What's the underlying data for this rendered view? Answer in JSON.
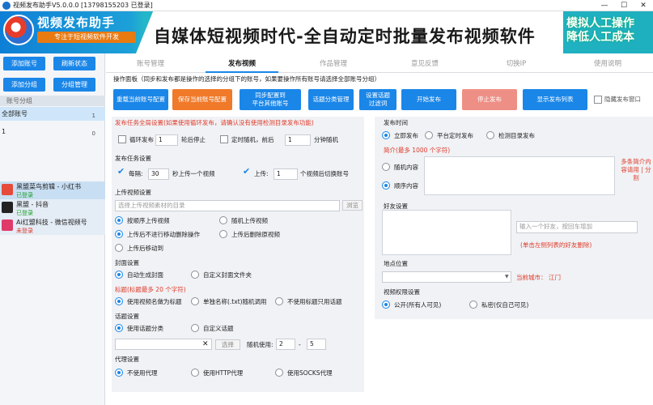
{
  "window": {
    "title": "视频发布助手V5.0.0.0 [13798155203 已登录]"
  },
  "banner": {
    "app_name": "视频发布助手",
    "app_sub": "专注于短视频软件开发",
    "slogan": "自媒体短视频时代-全自动定时批量发布视频软件",
    "badge_line1": "模拟人工操作",
    "badge_line2": "降低人工成本"
  },
  "sidebar": {
    "buttons": [
      "添加账号",
      "刷新状态",
      "添加分组",
      "分组管理"
    ],
    "group_header": "账号分组",
    "groups": [
      {
        "name": "全部账号",
        "count": "1"
      },
      {
        "name": "1",
        "count": "0"
      }
    ],
    "accounts": [
      {
        "name": "黑盟菜鸟剪辑 - 小红书",
        "status": "已登录",
        "status_color": "#1a9e2a",
        "avatar_color": "#e64a3a"
      },
      {
        "name": "黑盟 - 抖音",
        "status": "已登录",
        "status_color": "#1a9e2a",
        "avatar_color": "#222222"
      },
      {
        "name": "Ai红盟科技 - 微信视频号",
        "status": "未登录",
        "status_color": "#e03a2a",
        "avatar_color": "#e03a6a"
      }
    ]
  },
  "tabs": [
    "账号管理",
    "发布视频",
    "作品管理",
    "意见反馈",
    "切换IP",
    "使用说明"
  ],
  "ops": {
    "header": "操作面板（同步和发布都是操作的选择的分组下的账号，如果要操作所有账号请选择全部账号分组）",
    "btn1_l1": "重载当前账号配置",
    "btn2_l1": "保存当前账号配置",
    "btn3_l1": "同步配置到",
    "btn3_l2": "平台其他账号",
    "btn4_l1": "话题分类管理",
    "btn5_l1": "设置话题",
    "btn5_l2": "过滤词",
    "btn6_l1": "开始发布",
    "btn7_l1": "停止发布",
    "btn8_l1": "显示发布列表",
    "hide_window": "隐藏发布窗口"
  },
  "global": {
    "title": "发布任务全局设置(如果使用循环发布，请确认没有使用检测目录发布功能)",
    "loop_label": "循环发布",
    "loop_value": "1",
    "loop_suffix": "轮后停止",
    "random_label": "定时随机，前后",
    "random_value": "1",
    "random_suffix": "分钟随机"
  },
  "task": {
    "title": "发布任务设置",
    "every_label": "每隔:",
    "every_value": "30",
    "every_suffix": "秒上传一个视频",
    "upload_label": "上传:",
    "upload_value": "1",
    "upload_suffix": "个视频后切换账号"
  },
  "upload": {
    "title": "上传视频设置",
    "dir_placeholder": "选择上传视频素材的目录",
    "browse": "浏览",
    "opt1": "按顺序上传视频",
    "opt2": "随机上传视频",
    "opt3": "上传后不进行移动删除操作",
    "opt4": "上传后删除原视频",
    "opt5": "上传后移动到"
  },
  "cover": {
    "title": "封面设置",
    "opt1": "自动生成封面",
    "opt2": "自定义封面文件夹"
  },
  "vtitle": {
    "title": "标题(标题最多 20 个字符)",
    "opt1": "使用视频名做为标题",
    "opt2": "单独名称(.txt)随机调用",
    "opt3": "不使用标题只用话题"
  },
  "topic": {
    "title": "话题设置",
    "opt1": "使用话题分类",
    "opt2": "自定义话题",
    "select": "选择",
    "random_label": "随机使用:",
    "min": "2",
    "dash": "-",
    "max": "5"
  },
  "proxy": {
    "title": "代理设置",
    "opt1": "不使用代理",
    "opt2": "使用HTTP代理",
    "opt3": "使用SOCKS代理"
  },
  "publish_time": {
    "title": "发布时间",
    "opt1": "立即发布",
    "opt2": "平台定时发布",
    "opt3": "检测目录发布"
  },
  "intro": {
    "title": "简介(最多 1000 个字符)",
    "opt1": "随机内容",
    "opt2": "顺序内容",
    "note": "多条简介内容请用 | 分割"
  },
  "friends": {
    "title": "好友设置",
    "placeholder": "输入一个好友，按回车增加",
    "note": "(单击左侧列表的好友删除)"
  },
  "location": {
    "title": "地点位置",
    "city_label": "当前城市：",
    "city": "江门"
  },
  "perm": {
    "title": "视频权限设置",
    "opt1": "公开(所有人可见)",
    "opt2": "私密(仅自己可见)"
  }
}
